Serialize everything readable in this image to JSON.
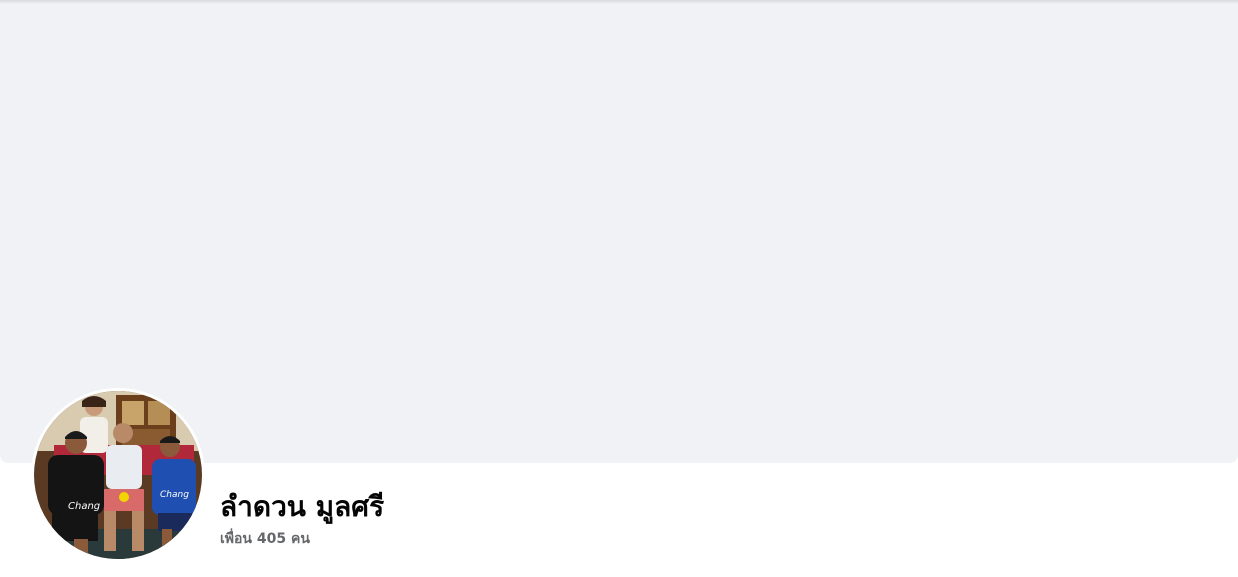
{
  "profile": {
    "name": "ลำดวน มูลศรี",
    "friends": "เพื่อน 405 คน"
  },
  "colors": {
    "cover_background": "#f0f2f5",
    "name_text": "#050505",
    "secondary_text": "#65676b"
  }
}
